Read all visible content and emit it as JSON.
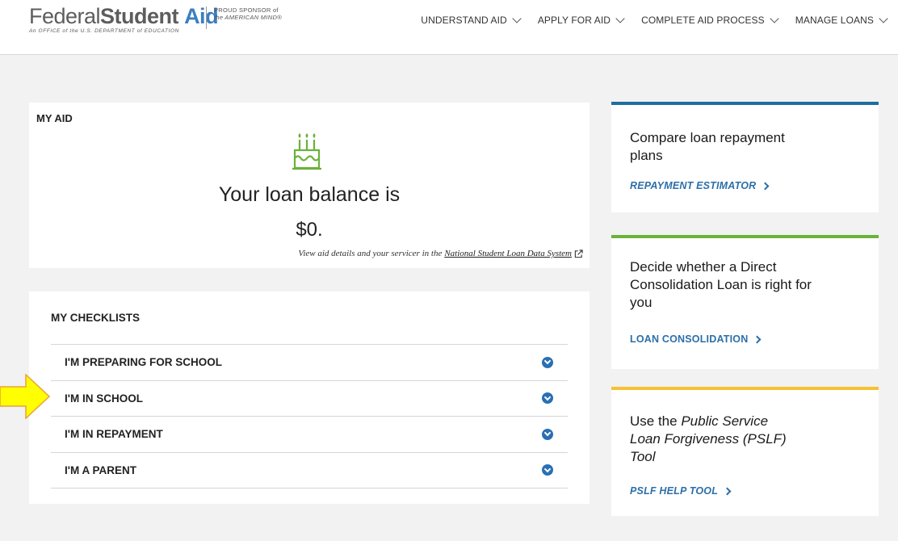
{
  "header": {
    "logo": {
      "word1": "Federal",
      "word2": "Student",
      "word3": "Aid",
      "subtitle": "An OFFICE of the U.S. DEPARTMENT of EDUCATION"
    },
    "sponsor": {
      "line1": "PROUD SPONSOR of",
      "line2": "the AMERICAN MIND®"
    },
    "nav": [
      {
        "label": "UNDERSTAND AID"
      },
      {
        "label": "APPLY FOR AID"
      },
      {
        "label": "COMPLETE AID PROCESS"
      },
      {
        "label": "MANAGE LOANS"
      }
    ]
  },
  "my_aid": {
    "title": "MY AID",
    "icon": "birthday-cake-icon",
    "balance_label": "Your loan balance is",
    "balance_value": "$0.",
    "nslds_text": "View aid details and your servicer in the",
    "nslds_link": "National Student Loan Data System"
  },
  "checklists": {
    "title": "MY CHECKLISTS",
    "items": [
      {
        "label": "I'M PREPARING FOR SCHOOL"
      },
      {
        "label": "I'M IN SCHOOL"
      },
      {
        "label": "I'M IN REPAYMENT"
      },
      {
        "label": "I'M A PARENT"
      }
    ]
  },
  "side_cards": [
    {
      "heading": "Compare loan repayment plans",
      "link": "REPAYMENT ESTIMATOR",
      "accent": "#1f6f9e"
    },
    {
      "heading": "Decide whether a Direct Consolidation Loan is right for you",
      "link": "LOAN CONSOLIDATION",
      "accent": "#6ab23a"
    },
    {
      "heading_prefix": "Use the",
      "heading_em": "Public Service Loan Forgiveness (PSLF) Tool",
      "link": "PSLF HELP TOOL",
      "accent": "#f5c231"
    }
  ],
  "colors": {
    "link_blue": "#2c6fa8",
    "cake_green": "#6ab23a",
    "arrow_yellow": "#ffff00",
    "arrow_outline": "#e8a33a"
  }
}
